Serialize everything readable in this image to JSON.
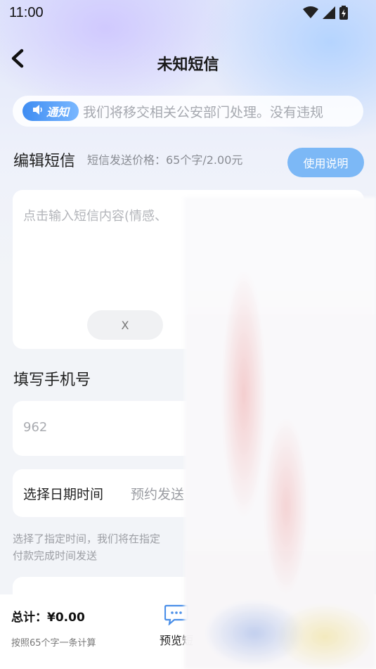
{
  "status_bar": {
    "time": "11:00"
  },
  "nav": {
    "title": "未知短信"
  },
  "notice": {
    "badge": "通知",
    "text": "我们将移交相关公安部门处理。没有违规"
  },
  "edit_section": {
    "title": "编辑短信",
    "price": "短信发送价格：65个字/2.00元",
    "help_label": "使用说明",
    "placeholder": "点击输入短信内容(情感、",
    "clear_label": "X"
  },
  "phone_section": {
    "title": "填写手机号",
    "value": "962"
  },
  "date_section": {
    "label": "选择日期时间",
    "value": "预约发送"
  },
  "hint": {
    "line1": "选择了指定时间，我们将在指定",
    "line2": "付款完成时间发送"
  },
  "bottom": {
    "total": "总计：¥0.00",
    "note": "按照65个字一条计算",
    "preview_label": "预览短"
  },
  "colors": {
    "accent": "#7cb8f6",
    "badge": "#3f8df2"
  }
}
